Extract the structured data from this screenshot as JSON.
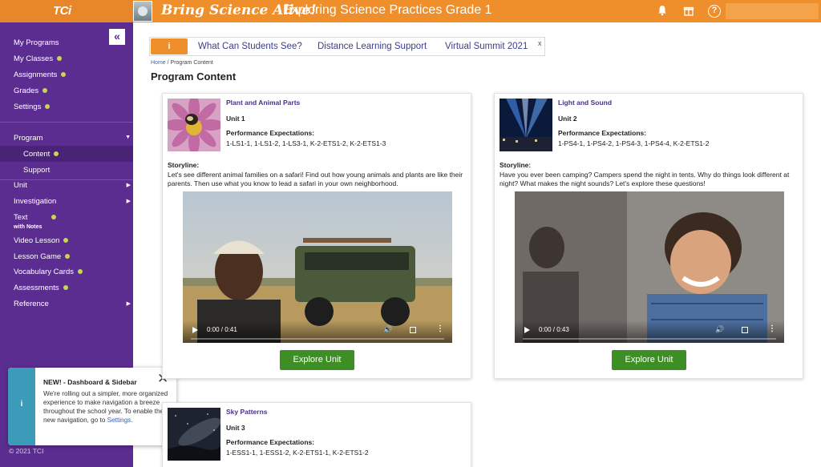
{
  "header": {
    "logo": "TCi",
    "brand": "Bring Science Alive!",
    "program_title": "Exploring Science Practices Grade 1",
    "icons": [
      "bell-icon",
      "gift-icon",
      "help-icon"
    ],
    "accent_color": "#ee8f2c"
  },
  "sidebar": {
    "collapse_glyph": "«",
    "items": [
      {
        "label": "My Programs"
      },
      {
        "label": "My Classes"
      },
      {
        "label": "Assignments"
      },
      {
        "label": "Grades"
      },
      {
        "label": "Settings"
      },
      {
        "label": "Program"
      },
      {
        "label": "Content"
      },
      {
        "label": "Support"
      },
      {
        "label": "Unit"
      },
      {
        "label": "Investigation"
      },
      {
        "label": "Text",
        "sublabel": "with Notes"
      },
      {
        "label": "Video Lesson"
      },
      {
        "label": "Lesson Game"
      },
      {
        "label": "Vocabulary Cards"
      },
      {
        "label": "Assessments"
      },
      {
        "label": "Reference"
      }
    ],
    "copyright": "© 2021 TCI",
    "color": "#5c2d91"
  },
  "toast": {
    "title": "NEW! - Dashboard & Sidebar",
    "body": "We're rolling out a simpler, more organized experience to make navigation a breeze throughout the school year. To enable the new navigation, go to",
    "link": "Settings",
    "end": "."
  },
  "banner": {
    "info_glyph": "i",
    "links": [
      "What Can Students See?",
      "Distance Learning Support",
      "Virtual Summit 2021"
    ],
    "close": "x"
  },
  "breadcrumb": {
    "home": "Home",
    "separator": " / ",
    "current": "Program Content"
  },
  "page_title": "Program Content",
  "units": [
    {
      "title": "Plant and Animal Parts",
      "unit": "Unit 1",
      "pe_label": "Performance Expectations:",
      "pe": "1-LS1-1, 1-LS1-2, 1-LS3-1, K-2-ETS1-2, K-2-ETS1-3",
      "storyline_label": "Storyline:",
      "storyline": "Let's see different animal families on a safari! Find out how young animals and plants are like their parents. Then use what you know to lead a safari in your own neighborhood.",
      "video_time": "0:00 / 0:41",
      "button": "Explore Unit"
    },
    {
      "title": "Light and Sound",
      "unit": "Unit 2",
      "pe_label": "Performance Expectations:",
      "pe": "1-PS4-1, 1-PS4-2, 1-PS4-3, 1-PS4-4, K-2-ETS1-2",
      "storyline_label": "Storyline:",
      "storyline": "Have you ever been camping? Campers spend the night in tents. Why do things look different at night? What makes the night sounds? Let's explore these questions!",
      "video_time": "0:00 / 0:43",
      "button": "Explore Unit"
    },
    {
      "title": "Sky Patterns",
      "unit": "Unit 3",
      "pe_label": "Performance Expectations:",
      "pe": "1-ESS1-1, 1-ESS1-2, K-2-ETS1-1, K-2-ETS1-2"
    }
  ],
  "button_color": "#3e8e26"
}
